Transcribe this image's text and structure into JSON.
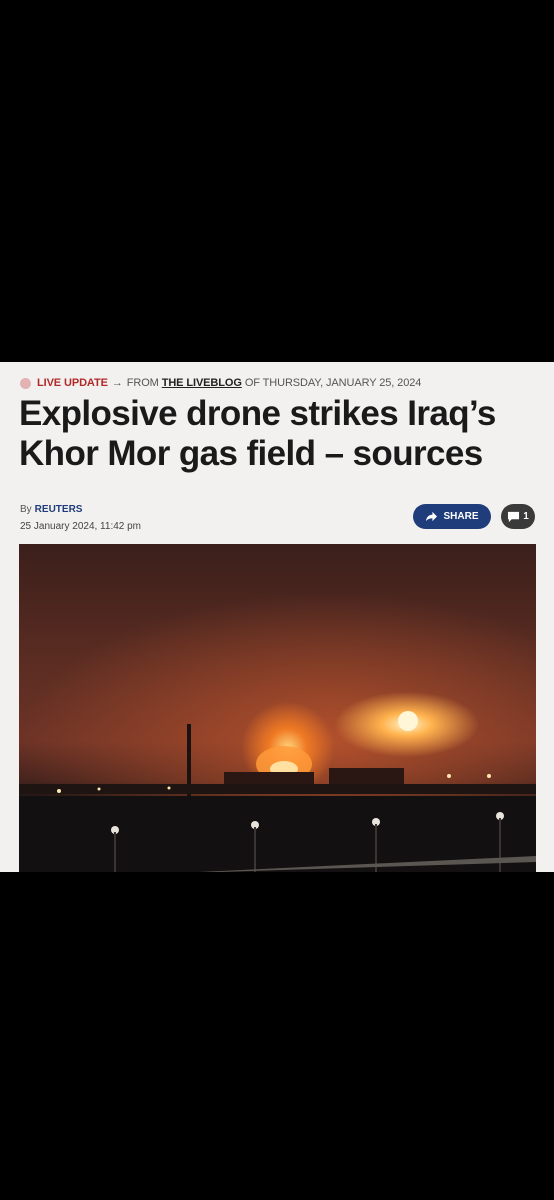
{
  "article": {
    "kicker": {
      "live_label": "LIVE UPDATE",
      "arrow": "→",
      "from_text": "FROM",
      "liveblog_link": "THE LIVEBLOG",
      "date_text": "OF THURSDAY, JANUARY 25, 2024"
    },
    "headline": "Explosive drone strikes Iraq’s Khor Mor gas field – sources",
    "byline": {
      "by_label": "By",
      "author": "REUTERS",
      "timestamp": "25 January 2024, 11:42 pm"
    },
    "actions": {
      "share_label": "SHARE",
      "comment_count": "1"
    },
    "colors": {
      "live_red": "#b02a2a",
      "brand_blue": "#1f3d7a",
      "background": "#f3f1ef"
    }
  }
}
